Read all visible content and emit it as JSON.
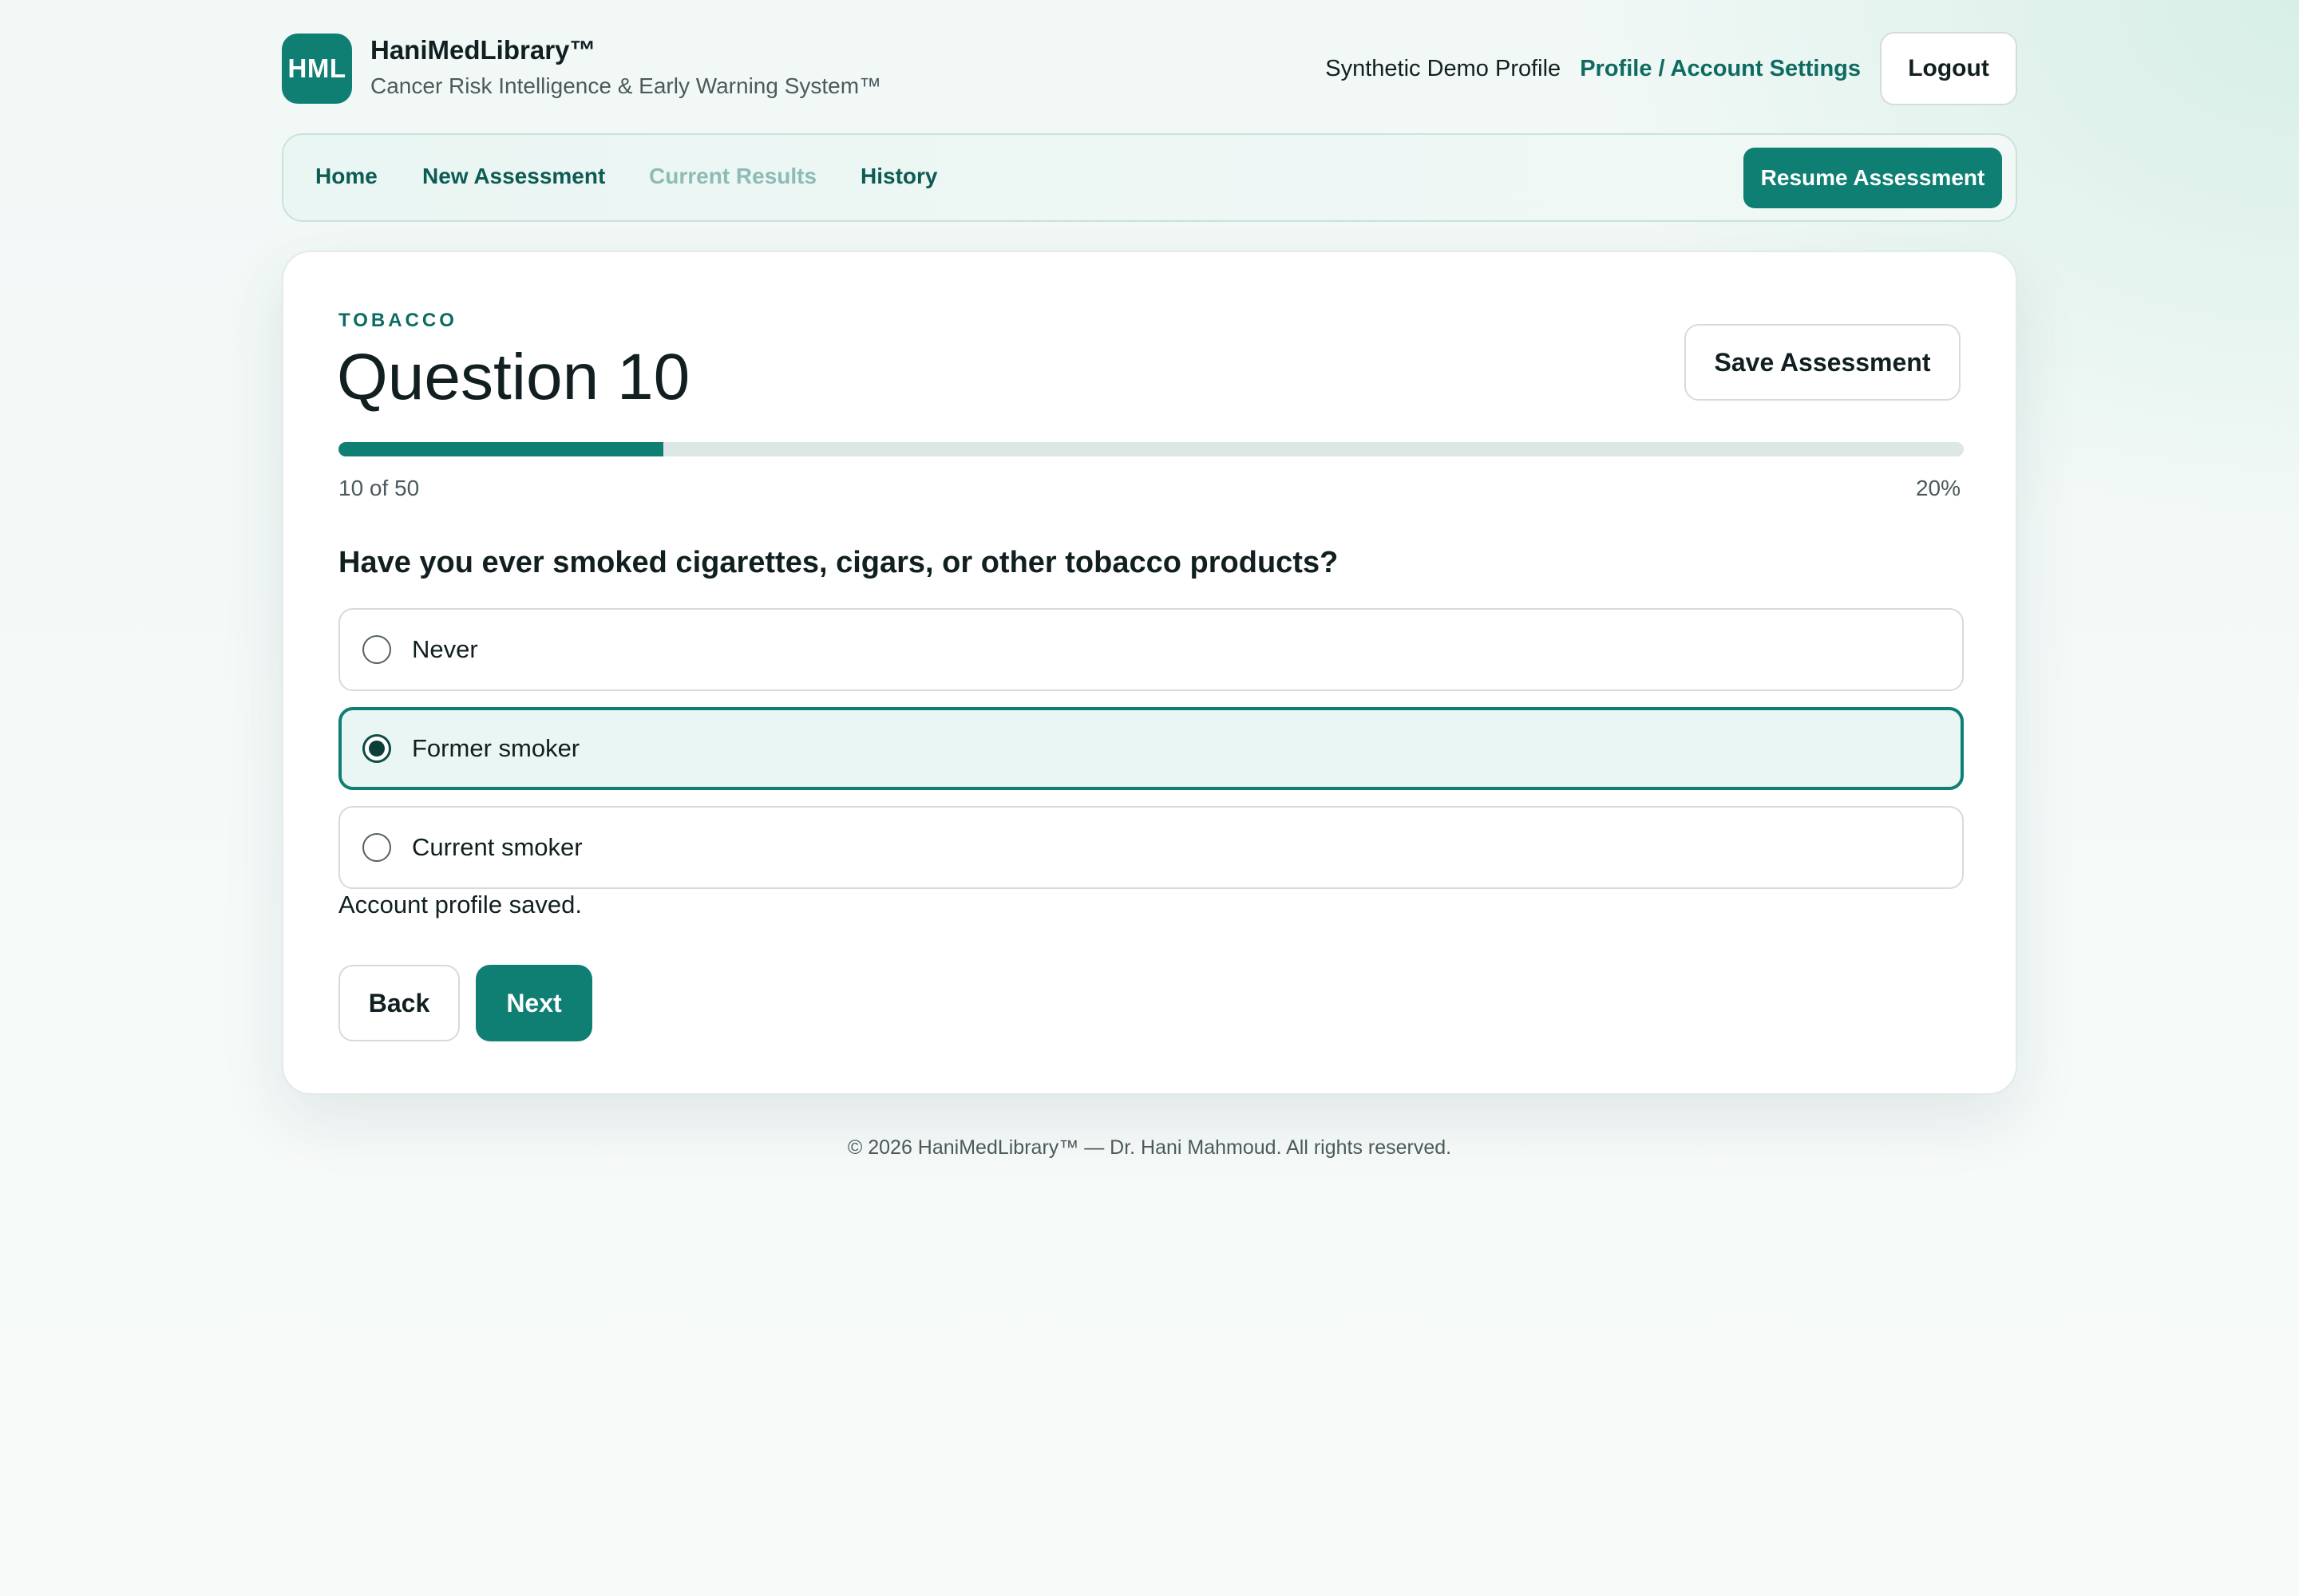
{
  "brand": {
    "logo_text": "HML",
    "title": "HaniMedLibrary™",
    "subtitle": "Cancer Risk Intelligence & Early Warning System™"
  },
  "header": {
    "profile_name": "Synthetic Demo Profile",
    "settings_link": "Profile / Account Settings",
    "logout_label": "Logout"
  },
  "nav": {
    "items": [
      {
        "label": "Home",
        "enabled": true
      },
      {
        "label": "New Assessment",
        "enabled": true
      },
      {
        "label": "Current Results",
        "enabled": false
      },
      {
        "label": "History",
        "enabled": true
      }
    ],
    "resume_label": "Resume Assessment"
  },
  "question": {
    "section": "TOBACCO",
    "title": "Question 10",
    "save_label": "Save Assessment",
    "progress_text": "10 of 50",
    "progress_percent_text": "20%",
    "progress_fraction": 0.2,
    "prompt": "Have you ever smoked cigarettes, cigars, or other tobacco products?",
    "options": [
      {
        "label": "Never",
        "selected": false
      },
      {
        "label": "Former smoker",
        "selected": true
      },
      {
        "label": "Current smoker",
        "selected": false
      }
    ],
    "status_message": "Account profile saved.",
    "back_label": "Back",
    "next_label": "Next"
  },
  "footer": {
    "text": "© 2026 HaniMedLibrary™ — Dr. Hani Mahmoud. All rights reserved."
  },
  "colors": {
    "accent": "#0f7f74",
    "accent_dark": "#0c5c54",
    "selected_bg": "#eaf6f3"
  }
}
